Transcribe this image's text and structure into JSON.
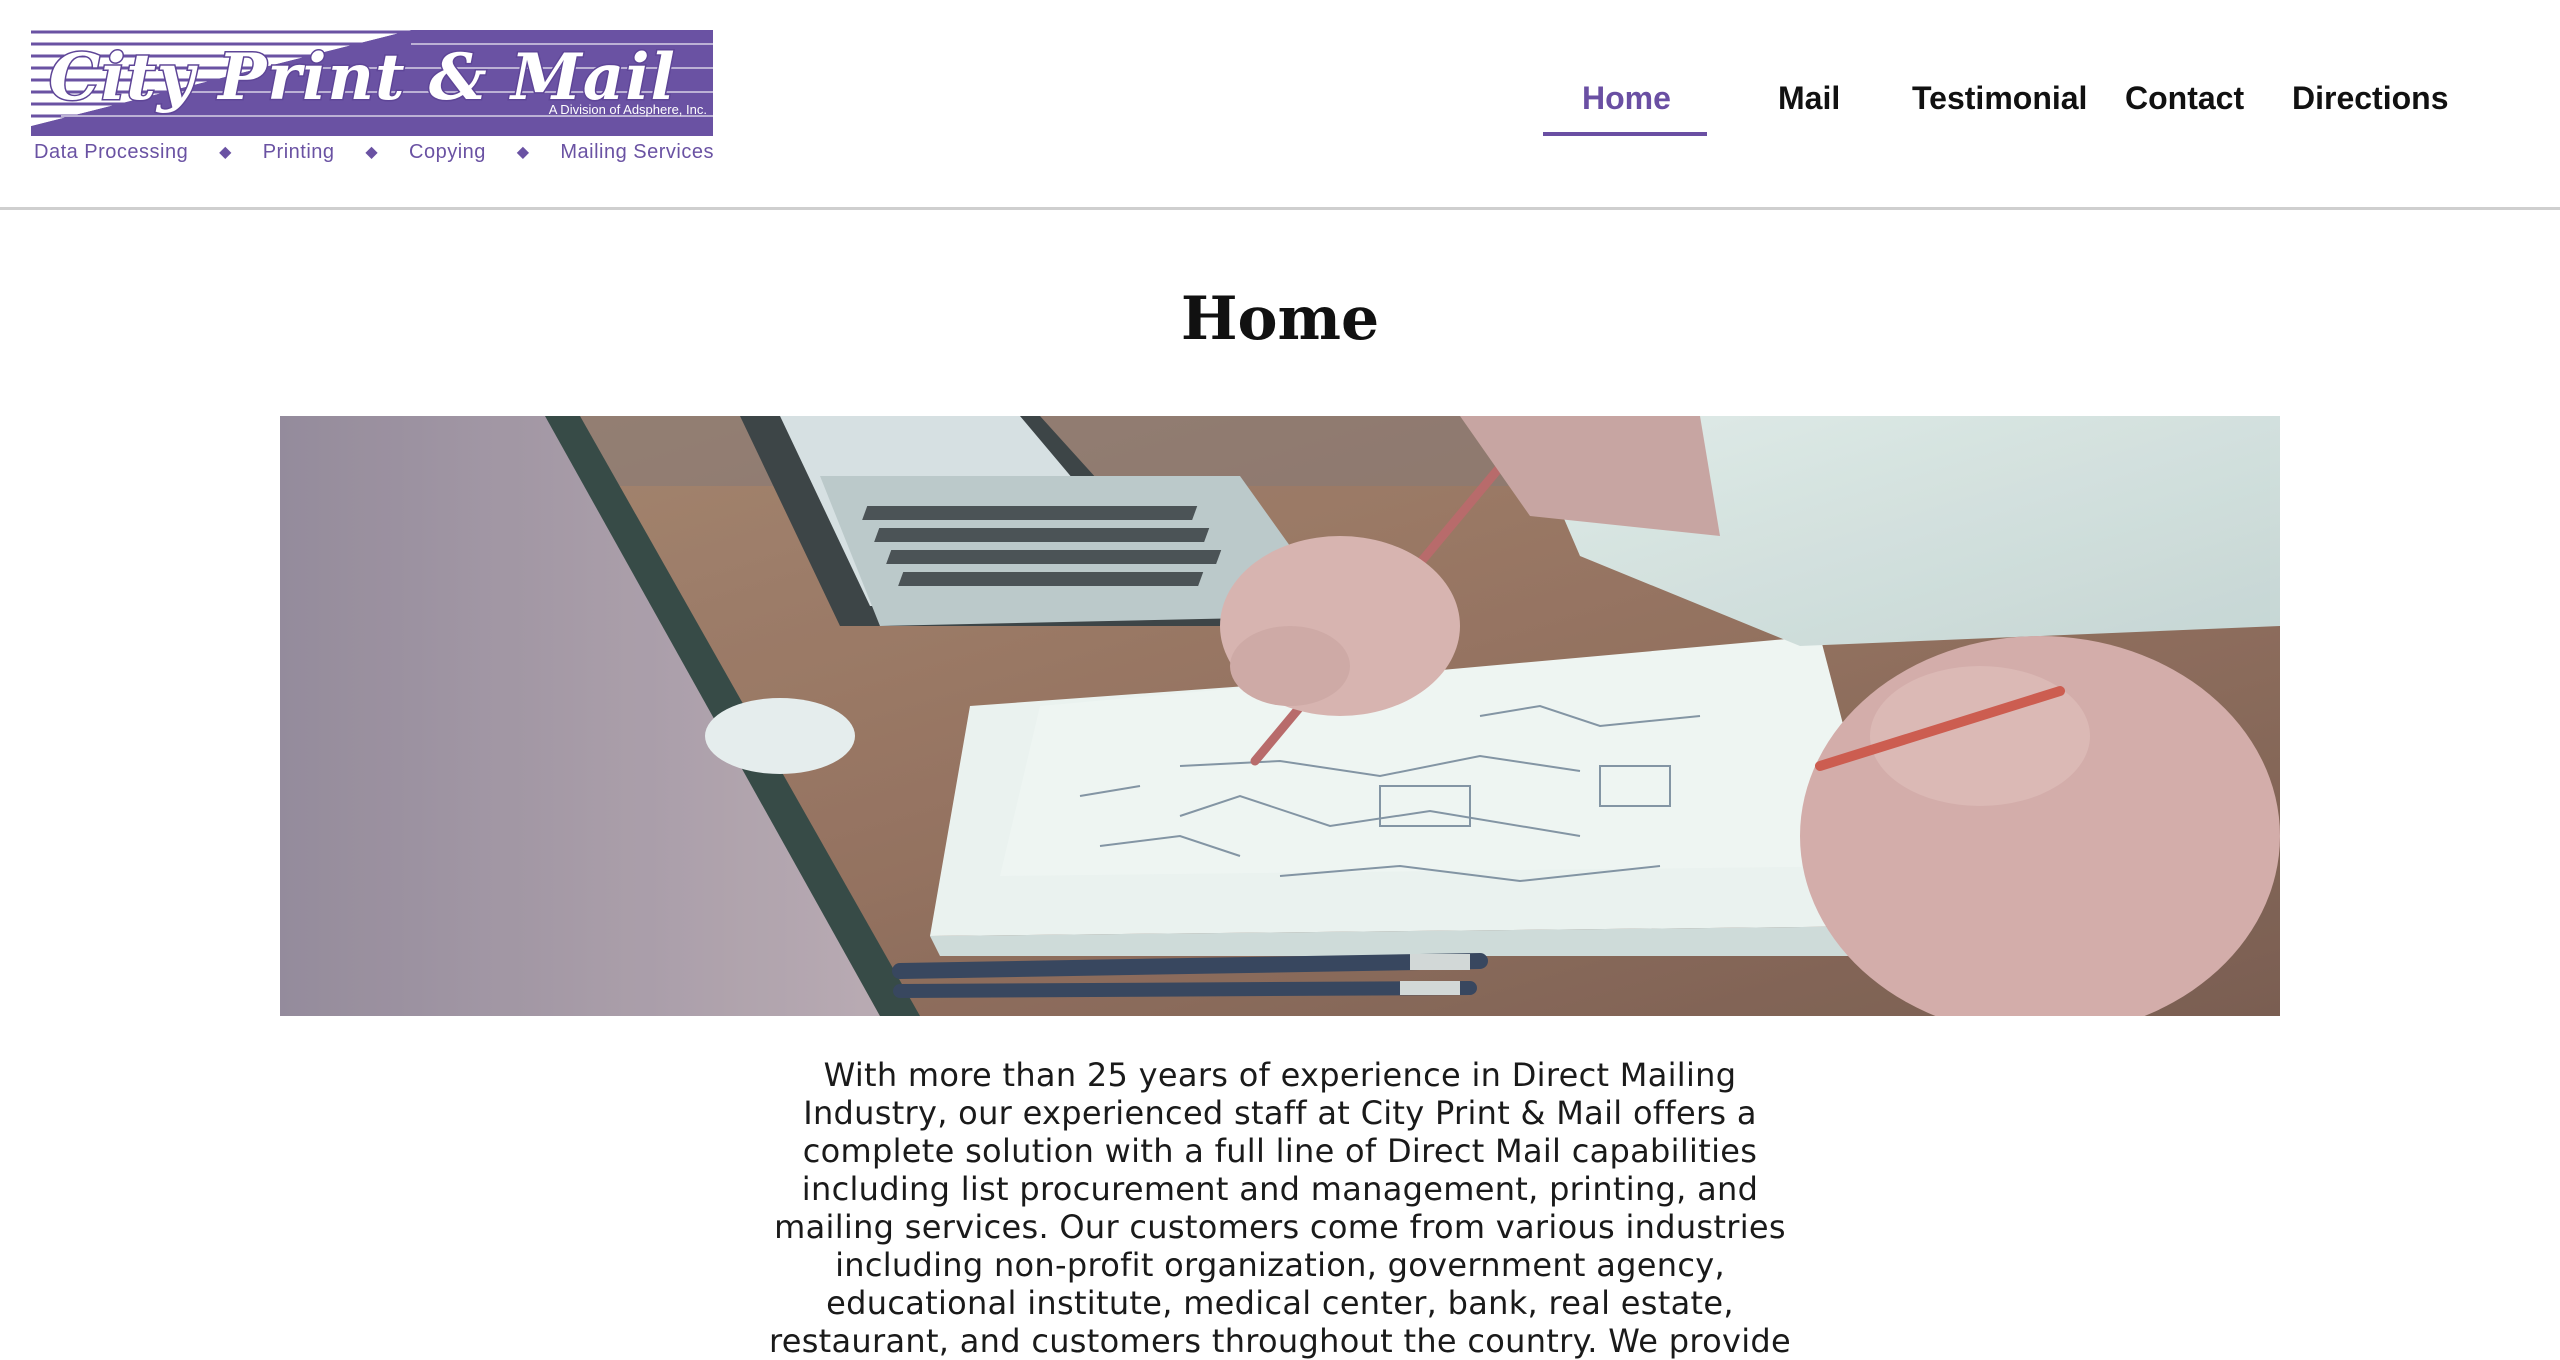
{
  "logo": {
    "title": "City Print & Mail",
    "division": "A Division of Adsphere, Inc.",
    "services": [
      "Data Processing",
      "Printing",
      "Copying",
      "Mailing Services"
    ],
    "brand_color": "#6a52a3"
  },
  "nav": {
    "items": [
      {
        "label": "Home",
        "active": true
      },
      {
        "label": "Mail",
        "active": false
      },
      {
        "label": "Testimonial",
        "active": false
      },
      {
        "label": "Contact",
        "active": false
      },
      {
        "label": "Directions",
        "active": false
      }
    ],
    "active_color": "#6a4fa3"
  },
  "main": {
    "title": "Home",
    "hero_image": "office-desk-planning-photo",
    "intro": "With more than 25 years of experience in Direct Mailing Industry, our experienced staff at City Print & Mail offers a complete solution with a full line of Direct Mail capabilities including list procurement and management, printing, and mailing services. Our customers come from various industries including non-profit organization, government agency, educational institute, medical center, bank, real estate, restaurant, and customers throughout the country. We provide"
  }
}
